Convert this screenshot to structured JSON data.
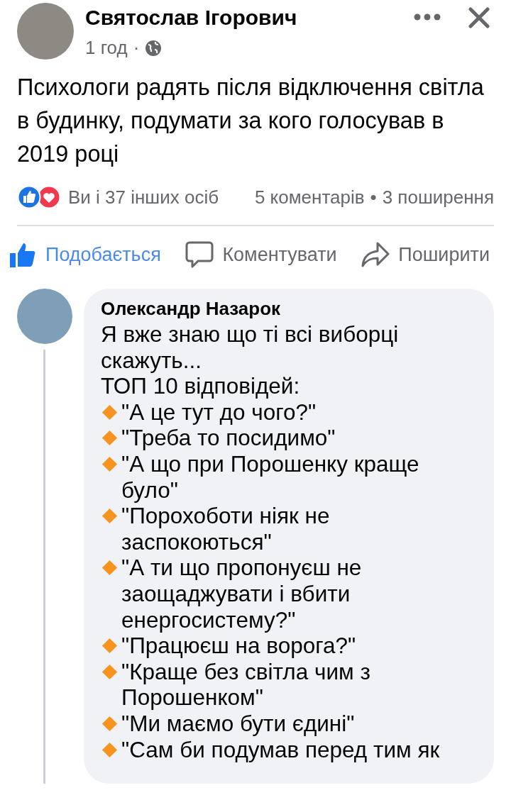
{
  "post": {
    "author": "Святослав Ігорович",
    "time": "1 год",
    "separator": "·",
    "text": "Психологи радять після відключення світла в будинку, подумати за кого голосував в 2019 році"
  },
  "reactions": {
    "summary": "Ви і 37 інших осіб",
    "comments": "5 коментарів",
    "dot": "•",
    "shares": "3 поширення"
  },
  "actions": [
    {
      "kind": "like",
      "label": "Подобається",
      "selected": true
    },
    {
      "kind": "comment",
      "label": "Коментувати",
      "selected": false
    },
    {
      "kind": "share",
      "label": "Поширити",
      "selected": false
    }
  ],
  "comment": {
    "author": "Олександр Назарок",
    "intro": [
      "Я вже знаю що ті всі виборці скажуть...",
      "ТОП 10 відповідей:"
    ],
    "items": [
      "\"А це тут до чого?\"",
      "\"Треба то посидимо\"",
      "\"А що при Порошенку краще було\"",
      "\"Порохоботи ніяк не заспокоються\"",
      "\"А ти що пропонуєш не заощаджувати і вбити енергосистему?\"",
      "\"Працюєш на ворога?\"",
      "\"Краще без світла чим з Порошенком\"",
      "\"Ми маємо бути єдині\"",
      "\"Сам би подумав перед тим як"
    ]
  }
}
